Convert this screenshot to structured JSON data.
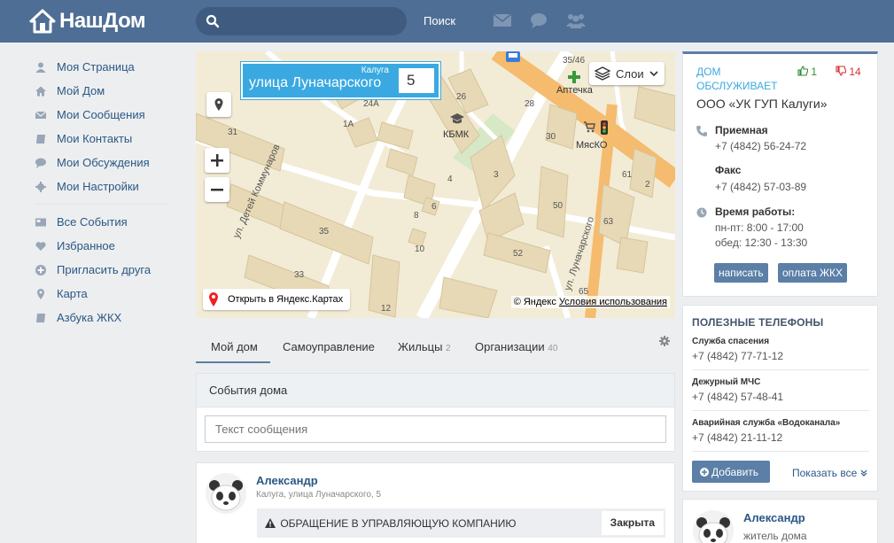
{
  "header": {
    "logo_text": "НашДом",
    "search_placeholder": "",
    "search_button": "Поиск",
    "icons": [
      "envelope-icon",
      "chat-icon",
      "users-icon"
    ]
  },
  "nav": {
    "primary": [
      {
        "label": "Моя Страница",
        "icon": "user-icon"
      },
      {
        "label": "Мой Дом",
        "icon": "home-icon"
      },
      {
        "label": "Мои Сообщения",
        "icon": "envelope-icon"
      },
      {
        "label": "Мои Контакты",
        "icon": "book-icon"
      },
      {
        "label": "Мои Обсуждения",
        "icon": "chat-icon"
      },
      {
        "label": "Мои Настройки",
        "icon": "gear-icon"
      }
    ],
    "secondary": [
      {
        "label": "Все События",
        "icon": "newspaper-icon"
      },
      {
        "label": "Избранное",
        "icon": "heart-icon"
      },
      {
        "label": "Пригласить друга",
        "icon": "plus-circle-icon"
      },
      {
        "label": "Карта",
        "icon": "map-marker-icon"
      },
      {
        "label": "Азбука ЖКХ",
        "icon": "book-icon"
      }
    ]
  },
  "map": {
    "city": "Калуга",
    "street": "улица Луначарского",
    "house_number": "5",
    "layers_label": "Слои",
    "open_label": "Открыть в Яндекс.Картах",
    "copyright": "© Яндекс",
    "terms": "Условия использования",
    "labels": {
      "l31": "31",
      "l24a": "24А",
      "l1a": "1А",
      "l26": "26",
      "l28": "28",
      "l30": "30",
      "l35_46": "35/46",
      "l61": "61",
      "l2": "2",
      "l3": "3",
      "l4": "4",
      "l6": "6",
      "l8": "8",
      "l10": "10",
      "l12": "12",
      "l33": "33",
      "l35": "35",
      "l50": "50",
      "l52": "52",
      "l63": "63",
      "l65": "65",
      "kbmk": "КБМК",
      "apteka": "Аптечка",
      "myasko": "МясКО",
      "street1": "ул. Детей Коммунаров",
      "street2": "ул. Луначарского"
    }
  },
  "tabs": [
    {
      "label": "Мой дом",
      "count": ""
    },
    {
      "label": "Самоуправление",
      "count": ""
    },
    {
      "label": "Жильцы",
      "count": "2"
    },
    {
      "label": "Организации",
      "count": "40"
    }
  ],
  "events": {
    "title": "События дома",
    "placeholder": "Текст сообщения"
  },
  "post": {
    "author": "Александр",
    "address": "Калуга, улица Луначарского, 5",
    "subject": "ОБРАЩЕНИЕ В УПРАВЛЯЮЩУЮ КОМПАНИЮ",
    "status": "Закрыта"
  },
  "manager": {
    "label": "ДОМ ОБСЛУЖИВАЕТ",
    "likes": "1",
    "dislikes": "14",
    "org": "ООО «УК ГУП Калуги»",
    "reception_title": "Приемная",
    "reception_phone": "+7 (4842) 56-24-72",
    "fax_title": "Факс",
    "fax_phone": "+7 (4842) 57-03-89",
    "hours_title": "Время работы:",
    "hours_weekdays": "пн-пт: 8:00 - 17:00",
    "hours_lunch": "обед: 12:30 - 13:30",
    "write_button": "написать",
    "pay_button": "оплата ЖКХ"
  },
  "phones": {
    "title": "ПОЛЕЗНЫЕ ТЕЛЕФОНЫ",
    "items": [
      {
        "name": "Служба спасения",
        "phone": "+7 (4842) 77-71-12"
      },
      {
        "name": "Дежурный МЧС",
        "phone": "+7 (4842) 57-48-41"
      },
      {
        "name": "Аварийная служба «Водоканала»",
        "phone": "+7 (4842) 21-11-12"
      }
    ],
    "add_button": "Добавить",
    "show_all": "Показать все"
  },
  "resident": {
    "author": "Александр",
    "role": "житель дома"
  },
  "colors": {
    "header_bg": "#4e6e95",
    "accent": "#5b7fa6",
    "link": "#2a5885",
    "map_label_bg": "#3ba9e1",
    "likes": "#2e8b2e",
    "dislikes": "#d53030"
  }
}
